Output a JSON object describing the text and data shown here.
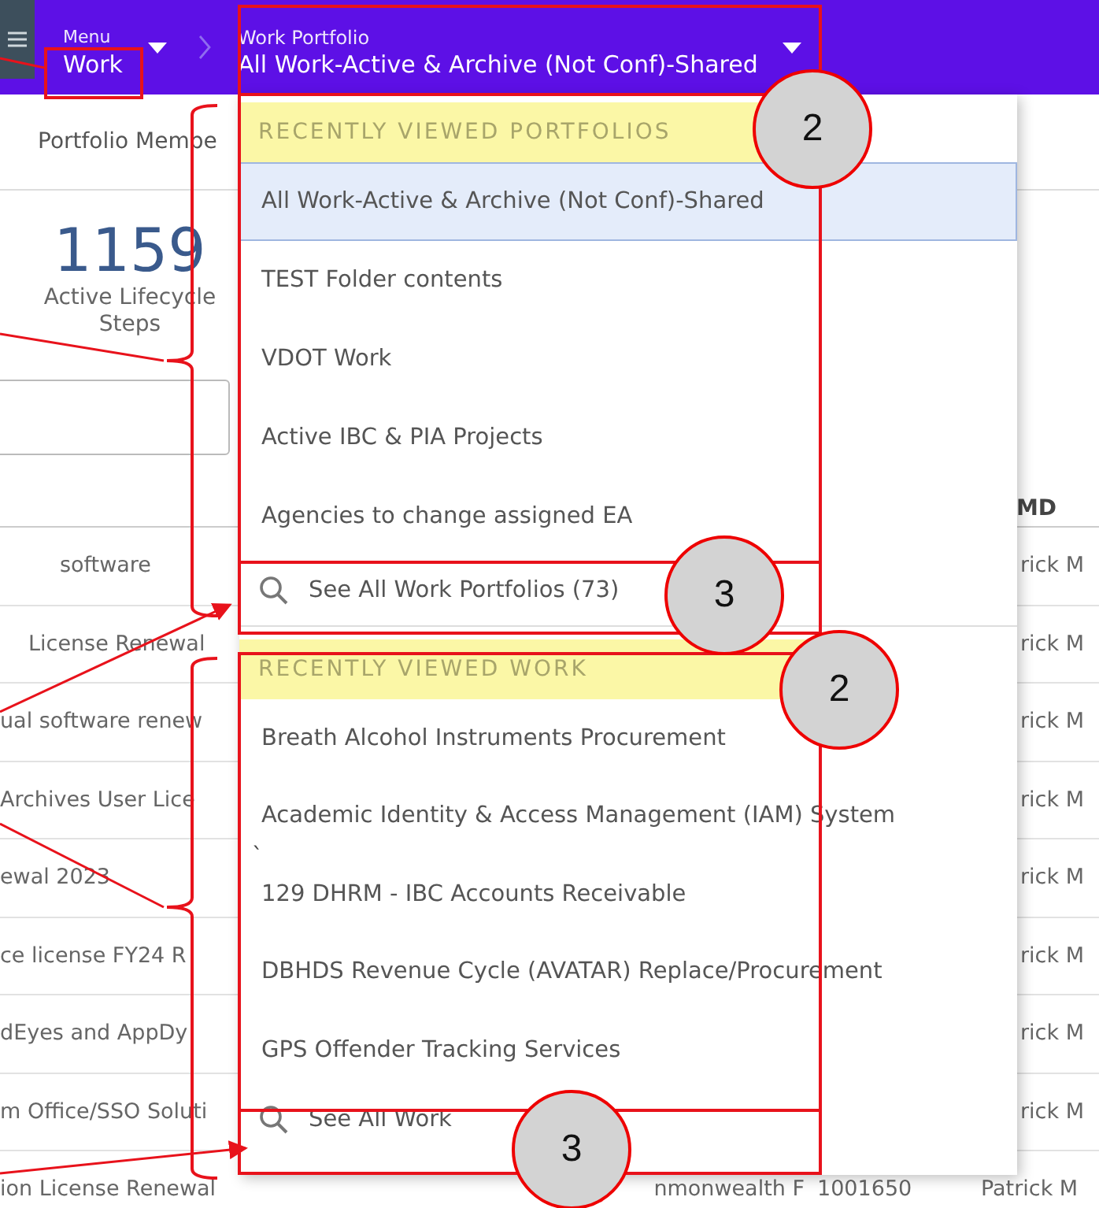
{
  "header": {
    "menu_label": "Menu",
    "menu_value": "Work",
    "portfolio_label": "Work Portfolio",
    "portfolio_value": "All Work-Active & Archive (Not Conf)-Shared"
  },
  "page": {
    "tab": "Portfolio Membe",
    "stat_value": "1159",
    "stat_label": "Active Lifecycle Steps"
  },
  "table": {
    "column_header": "MD",
    "rows": [
      {
        "cells": [
          "software",
          "rick M"
        ]
      },
      {
        "cells": [
          "License Renewal",
          "rick M"
        ]
      },
      {
        "cells": [
          "ual software renew",
          "rick M"
        ]
      },
      {
        "cells": [
          "Archives User Lice",
          "rick M"
        ]
      },
      {
        "cells": [
          "ewal 2023",
          "rick M"
        ]
      },
      {
        "cells": [
          "ce license FY24 R",
          "rick M"
        ]
      },
      {
        "cells": [
          "dEyes and AppDy",
          "rick M"
        ]
      },
      {
        "cells": [
          "m Office/SSO Soluti",
          "rick M"
        ]
      },
      {
        "cells": [
          "ion License Renewal",
          "nmonwealth F",
          "1001650",
          "Patrick M"
        ]
      }
    ]
  },
  "dropdown": {
    "sections": [
      {
        "heading": "RECENTLY VIEWED PORTFOLIOS",
        "items": [
          {
            "label": "All Work-Active & Archive (Not Conf)-Shared",
            "selected": true
          },
          {
            "label": "TEST Folder contents",
            "selected": false
          },
          {
            "label": "VDOT Work",
            "selected": false
          },
          {
            "label": "Active IBC & PIA Projects",
            "selected": false
          },
          {
            "label": "Agencies to change assigned EA",
            "selected": false
          }
        ],
        "see_all": "See All Work Portfolios (73)"
      },
      {
        "heading": "RECENTLY VIEWED WORK",
        "items": [
          {
            "label": "Breath Alcohol Instruments Procurement"
          },
          {
            "label": "Academic Identity & Access Management (IAM) System"
          },
          {
            "label": "129 DHRM - IBC Accounts Receivable"
          },
          {
            "label": "DBHDS Revenue Cycle (AVATAR) Replace/Procurement"
          },
          {
            "label": "GPS Offender Tracking Services"
          }
        ],
        "see_all": "See All Work"
      }
    ],
    "stray_mark": "`"
  },
  "callouts": [
    {
      "number": "2"
    },
    {
      "number": "3"
    },
    {
      "number": "2"
    },
    {
      "number": "3"
    }
  ]
}
